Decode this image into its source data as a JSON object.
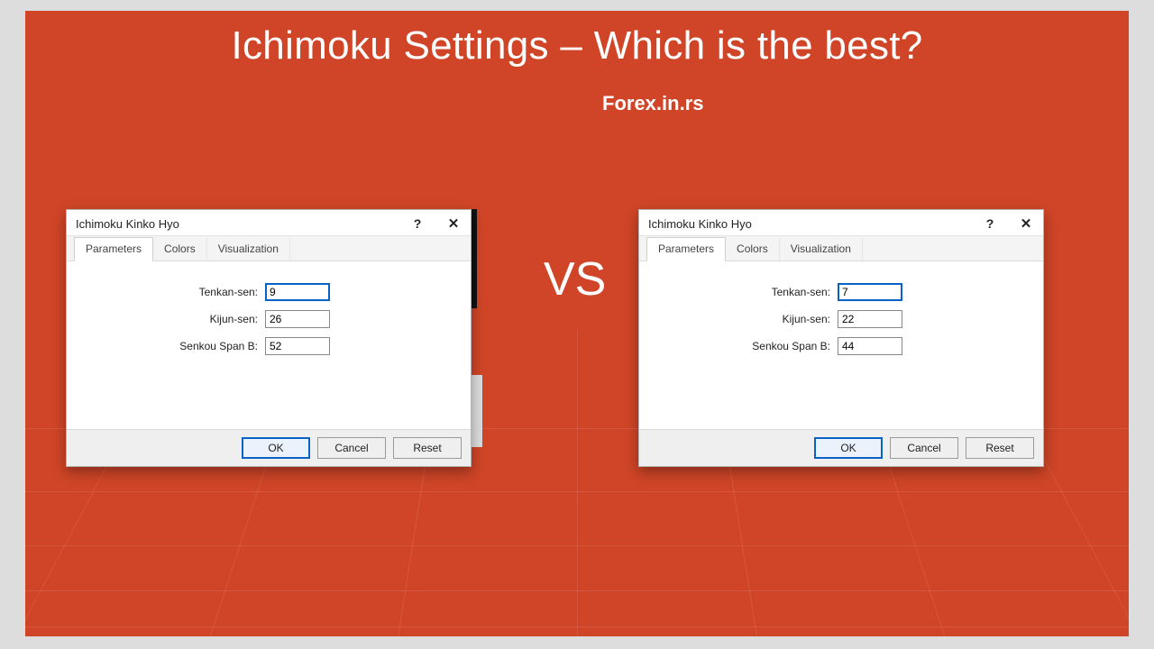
{
  "slide": {
    "title": "Ichimoku Settings – Which is the best?",
    "subtitle": "Forex.in.rs",
    "vs": "VS"
  },
  "dialog": {
    "title": "Ichimoku Kinko Hyo",
    "help_symbol": "?",
    "close_symbol": "✕",
    "tabs": {
      "parameters": "Parameters",
      "colors": "Colors",
      "visualization": "Visualization"
    },
    "fields": {
      "tenkan_label": "Tenkan-sen:",
      "kijun_label": "Kijun-sen:",
      "senkou_label": "Senkou Span B:"
    },
    "buttons": {
      "ok": "OK",
      "cancel": "Cancel",
      "reset": "Reset"
    }
  },
  "left": {
    "tenkan": "9",
    "kijun": "26",
    "senkou": "52"
  },
  "right": {
    "tenkan": "7",
    "kijun": "22",
    "senkou": "44"
  }
}
